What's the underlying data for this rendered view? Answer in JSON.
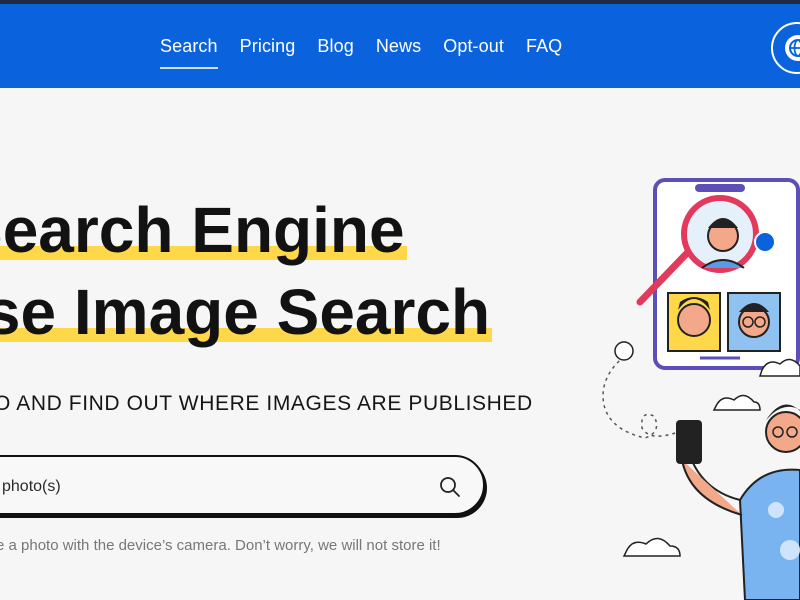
{
  "nav": {
    "items": [
      {
        "label": "Search",
        "active": true
      },
      {
        "label": "Pricing",
        "active": false
      },
      {
        "label": "Blog",
        "active": false
      },
      {
        "label": "News",
        "active": false
      },
      {
        "label": "Opt-out",
        "active": false
      },
      {
        "label": "FAQ",
        "active": false
      }
    ],
    "language_icon": "globe-icon"
  },
  "hero": {
    "line1": "Search Engine",
    "line2": "rse Image Search",
    "subtitle": "O AND FIND OUT WHERE IMAGES ARE PUBLISHED"
  },
  "search": {
    "placeholder": "photo(s)",
    "icon": "search-icon",
    "hint": "e a photo with the device’s camera. Don’t worry, we will not store it!"
  },
  "colors": {
    "header_bg": "#0a63dc",
    "highlight": "#ffd84a",
    "page_bg": "#f6f6f6",
    "illustration_accent": "#e13a5c",
    "illustration_blue": "#5a9be6"
  }
}
